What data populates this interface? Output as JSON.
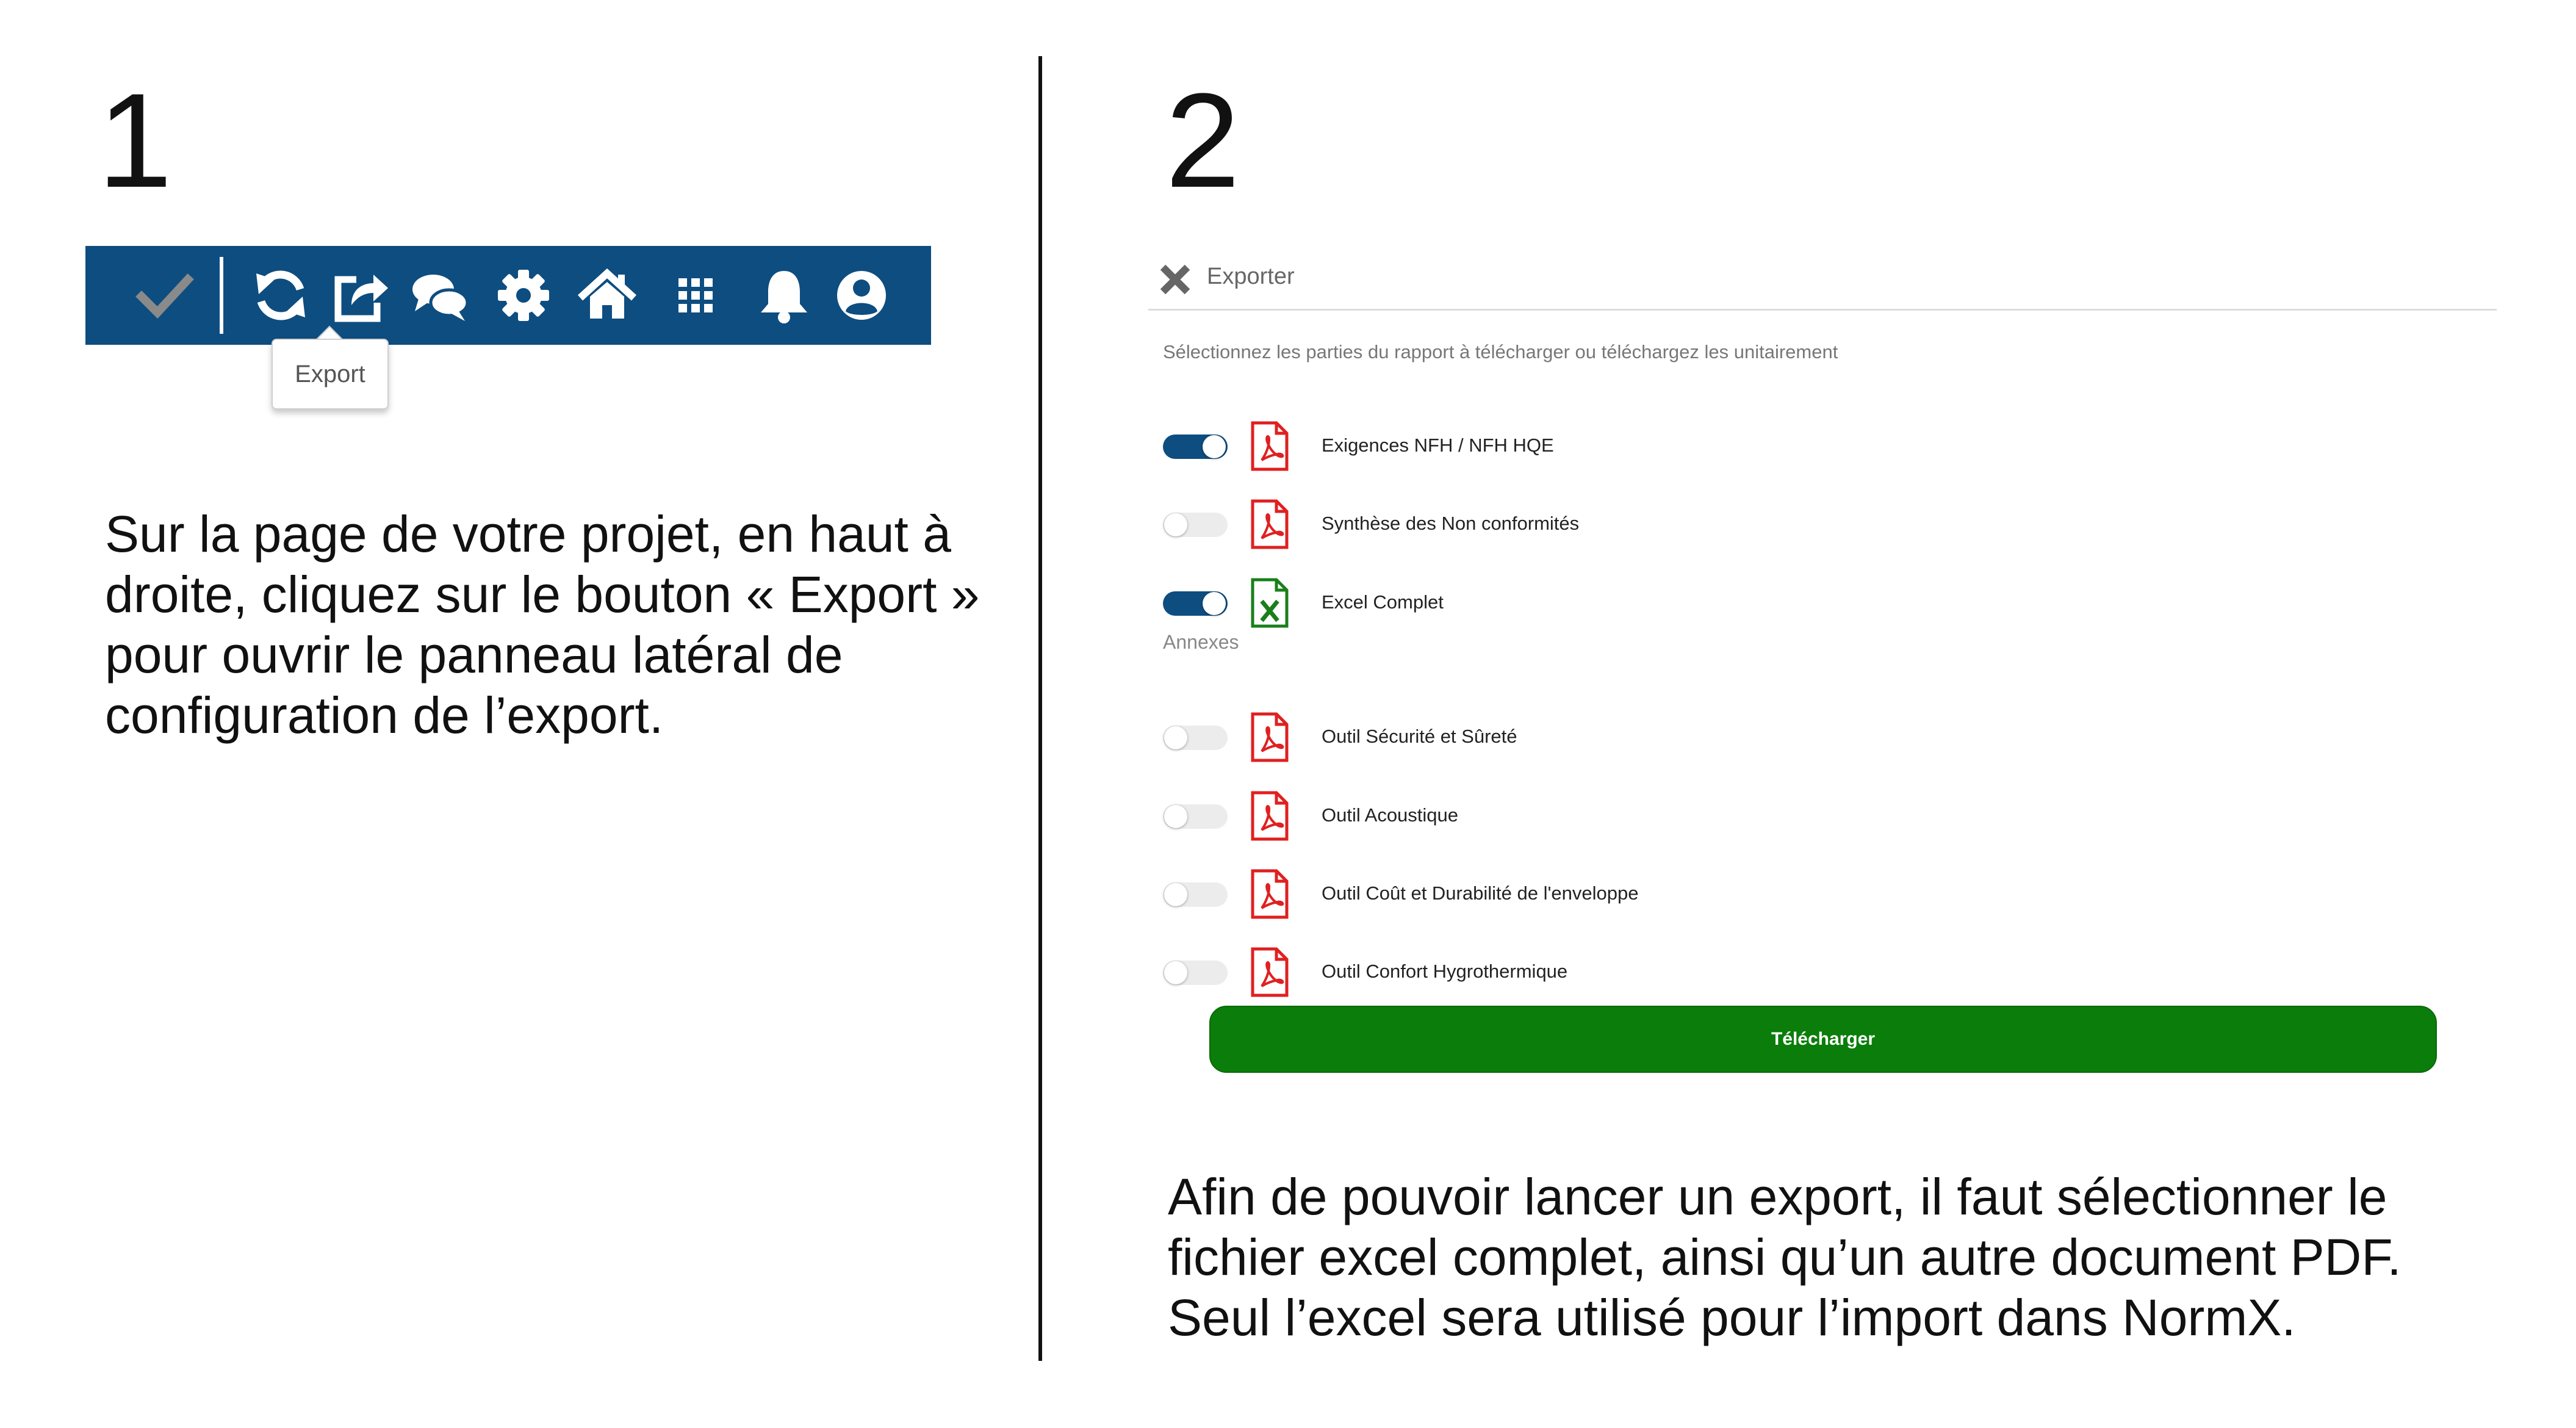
{
  "steps": [
    {
      "number": "1",
      "description": "Sur la page de votre projet, en haut à droite, cliquez sur le bouton « Export » pour ouvrir le panneau latéral de configuration de l’export."
    },
    {
      "number": "2",
      "description": "Afin de pouvoir lancer un export, il faut sélectionner le fichier excel complet, ainsi qu’un autre document PDF. Seul l’excel sera utilisé pour l’import dans NormX."
    }
  ],
  "toolbar": {
    "color": "#0e4d80",
    "icons": [
      "check-icon",
      "refresh-icon",
      "export-icon",
      "comments-icon",
      "gear-icon",
      "home-icon",
      "grid-apps-icon",
      "bell-icon",
      "user-account-icon"
    ],
    "tooltip": "Export"
  },
  "panel": {
    "title": "Exporter",
    "instructions": "Sélectionnez les parties du rapport à télécharger ou téléchargez les unitairement",
    "items": [
      {
        "label": "Exigences NFH / NFH HQE",
        "enabled": true,
        "file_type": "pdf"
      },
      {
        "label": "Synthèse des Non conformités",
        "enabled": false,
        "file_type": "pdf"
      },
      {
        "label": "Excel Complet",
        "enabled": true,
        "file_type": "excel"
      }
    ],
    "annexes_label": "Annexes",
    "annexes": [
      {
        "label": "Outil Sécurité et Sûreté",
        "enabled": false,
        "file_type": "pdf"
      },
      {
        "label": "Outil Acoustique",
        "enabled": false,
        "file_type": "pdf"
      },
      {
        "label": "Outil Coût et Durabilité de l'enveloppe",
        "enabled": false,
        "file_type": "pdf"
      },
      {
        "label": "Outil Confort Hygrothermique",
        "enabled": false,
        "file_type": "pdf"
      }
    ],
    "download_label": "Télécharger",
    "colors": {
      "toggle_on": "#0e4d80",
      "pdf": "#e02020",
      "excel": "#1a7f1a",
      "button": "#0a7d0a"
    }
  }
}
